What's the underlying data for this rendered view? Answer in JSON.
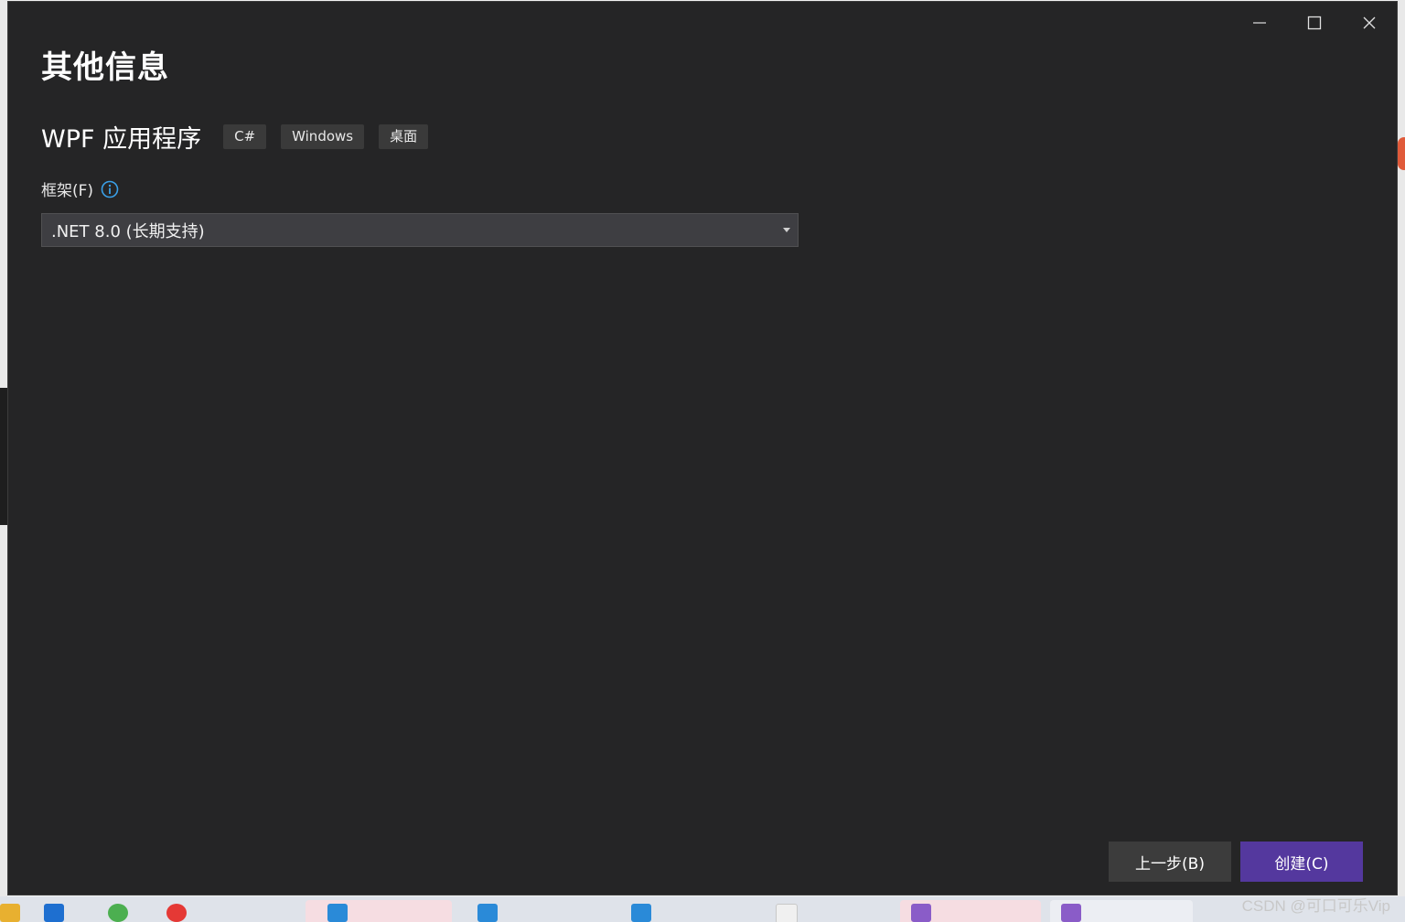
{
  "dialog": {
    "title": "其他信息",
    "project_name": "WPF 应用程序",
    "tags": [
      "C#",
      "Windows",
      "桌面"
    ],
    "framework_label": "框架(F)",
    "framework_value": ".NET 8.0 (长期支持)",
    "back_button": "上一步(B)",
    "create_button": "创建(C)"
  },
  "watermark": "CSDN @可口可乐Vip",
  "colors": {
    "dialog_bg": "#252526",
    "create_accent": "#54389e",
    "info_icon": "#3aa0e8"
  }
}
